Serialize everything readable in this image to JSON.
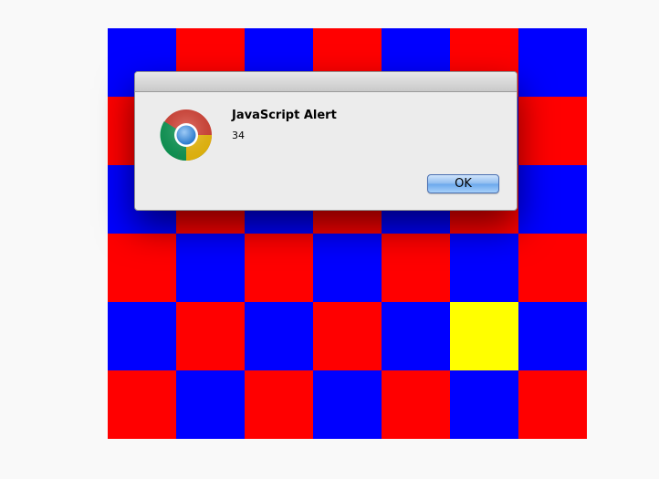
{
  "board": {
    "rows": [
      [
        "blue",
        "red",
        "blue",
        "red",
        "blue",
        "red",
        "blue"
      ],
      [
        "red",
        "blue",
        "red",
        "blue",
        "red",
        "blue",
        "red"
      ],
      [
        "blue",
        "red",
        "blue",
        "red",
        "blue",
        "red",
        "blue"
      ],
      [
        "red",
        "blue",
        "red",
        "blue",
        "red",
        "blue",
        "red"
      ],
      [
        "blue",
        "red",
        "blue",
        "red",
        "blue",
        "yellow",
        "blue"
      ],
      [
        "red",
        "blue",
        "red",
        "blue",
        "red",
        "blue",
        "red"
      ]
    ],
    "colors": {
      "red": "#ff0000",
      "blue": "#0000ff",
      "yellow": "#ffff00"
    }
  },
  "alert": {
    "icon": "chrome-logo-icon",
    "title": "JavaScript Alert",
    "message": "34",
    "ok_label": "OK"
  }
}
